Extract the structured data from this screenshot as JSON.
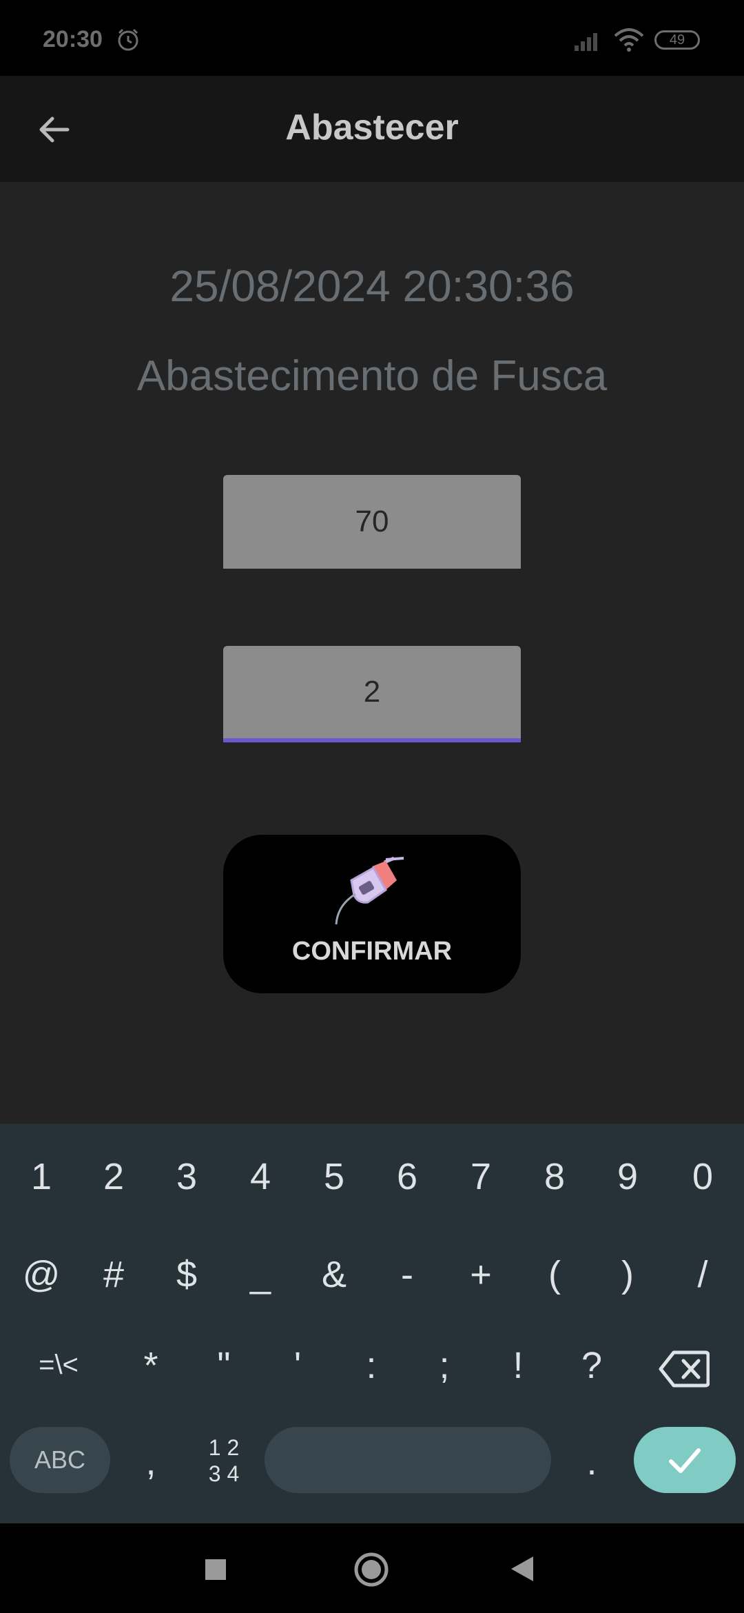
{
  "status": {
    "time": "20:30",
    "battery": "49"
  },
  "header": {
    "title": "Abastecer"
  },
  "main": {
    "datetime": "25/08/2024 20:30:36",
    "subtitle": "Abastecimento de Fusca",
    "field1_value": "70",
    "field2_value": "2",
    "confirm_label": "CONFIRMAR"
  },
  "keyboard": {
    "row1": [
      "1",
      "2",
      "3",
      "4",
      "5",
      "6",
      "7",
      "8",
      "9",
      "0"
    ],
    "row2": [
      "@",
      "#",
      "$",
      "_",
      "&",
      "-",
      "+",
      "(",
      ")",
      "/"
    ],
    "row3": [
      "=\\<",
      "*",
      "\"",
      "'",
      ":",
      ";",
      "!",
      "?"
    ],
    "abc_label": "ABC",
    "comma": ",",
    "numpad_label_top": "1 2",
    "numpad_label_bottom": "3 4",
    "period": "."
  },
  "colors": {
    "accent": "#6a5acd",
    "enter_key": "#80cbc4"
  }
}
